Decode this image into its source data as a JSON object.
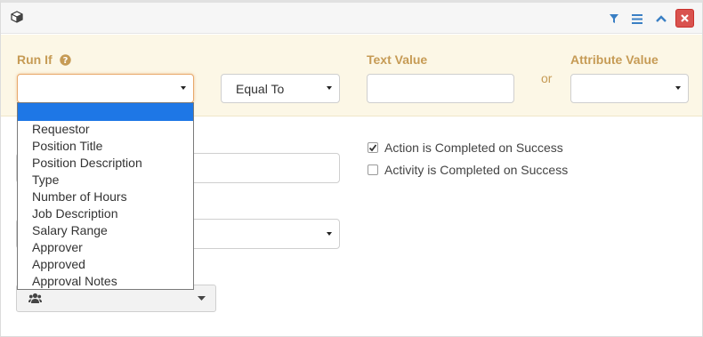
{
  "header": {
    "icon": "cube-icon",
    "actions": [
      "filter-icon",
      "list-icon",
      "chevron-up-icon",
      "close-icon"
    ],
    "close_color": "#d9534f"
  },
  "condition": {
    "run_if_label": "Run If",
    "run_if_value": "",
    "operator_value": "Equal To",
    "text_value_label": "Text Value",
    "text_value": "",
    "or_label": "or",
    "attribute_value_label": "Attribute Value",
    "attribute_value": ""
  },
  "run_if_options": [
    "",
    "Requestor",
    "Position Title",
    "Position Description",
    "Type",
    "Number of Hours",
    "Job Description",
    "Salary Range",
    "Approver",
    "Approved",
    "Approval Notes"
  ],
  "selected_option_index": 0,
  "options": {
    "action_completed_label": "Action is Completed on Success",
    "action_completed_checked": true,
    "activity_completed_label": "Activity is Completed on Success",
    "activity_completed_checked": false
  },
  "colors": {
    "accent_label": "#c69b55",
    "condition_bg": "#fcf7e6",
    "header_icon": "#3a7fc4",
    "selected_option": "#1e77e6"
  }
}
